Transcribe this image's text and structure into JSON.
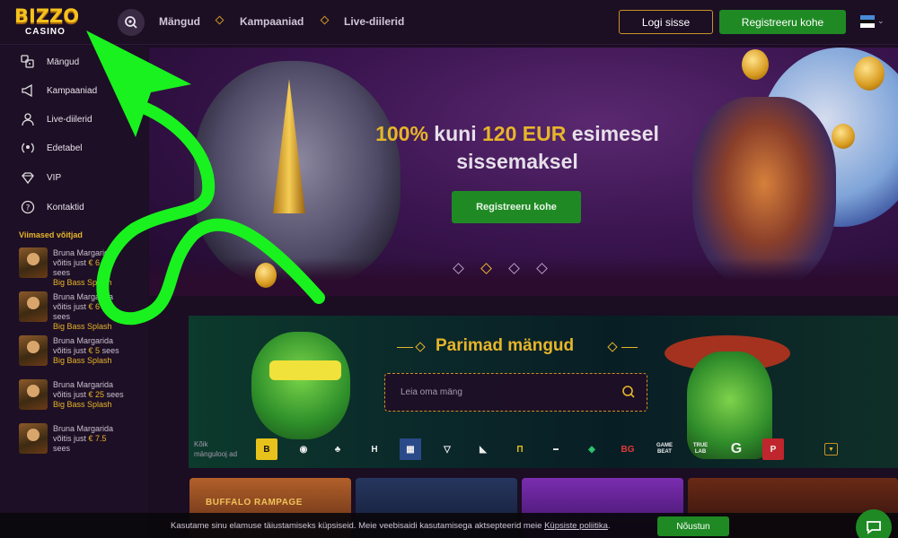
{
  "header": {
    "logo_top": "BIZZO",
    "logo_bottom": "CASINO",
    "nav": [
      "Mängud",
      "Kampaaniad",
      "Live-diilerid"
    ],
    "login_label": "Logi sisse",
    "register_label": "Registreeru kohe"
  },
  "sidebar": {
    "items": [
      {
        "label": "Mängud",
        "icon": "games-icon"
      },
      {
        "label": "Kampaaniad",
        "icon": "megaphone-icon"
      },
      {
        "label": "Live-diilerid",
        "icon": "live-dealer-icon"
      },
      {
        "label": "Edetabel",
        "icon": "laurel-icon"
      },
      {
        "label": "VIP",
        "icon": "diamond-icon"
      },
      {
        "label": "Kontaktid",
        "icon": "question-icon"
      }
    ],
    "winners_title": "Viimased võitjad",
    "winners": [
      {
        "name": "Bruna Margarida",
        "prefix": "võitis just",
        "amount": "€ 6",
        "suffix": "sees",
        "game": "Big Bass Splash"
      },
      {
        "name": "Bruna Margarida",
        "prefix": "võitis just",
        "amount": "€ 6",
        "suffix": "sees",
        "game": "Big Bass Splash"
      },
      {
        "name": "Bruna Margarida",
        "prefix": "võitis just",
        "amount": "€ 5",
        "suffix": "sees",
        "game": "Big Bass Splash"
      },
      {
        "name": "Bruna Margarida",
        "prefix": "võitis just",
        "amount": "€ 25",
        "suffix": "sees",
        "game": "Big Bass Splash"
      },
      {
        "name": "Bruna Margarida",
        "prefix": "võitis just",
        "amount": "€ 7.5",
        "suffix": "sees",
        "game": ""
      }
    ]
  },
  "hero": {
    "title_a": "100%",
    "title_b": " kuni ",
    "title_c": "120 EUR",
    "title_d": " esimesel",
    "title_line2": "sissemaksel",
    "cta_label": "Registreeru kohe",
    "slides": 4,
    "active_slide": 2
  },
  "games": {
    "title": "Parimad mängud",
    "search_placeholder": "Leia oma mäng",
    "providers_label_1": "Kõik",
    "providers_label_2": "mängulooj ad",
    "providers": [
      "B",
      "◉",
      "♣",
      "H",
      "▦",
      "▽",
      "◣",
      "Π",
      "▬",
      "◈",
      "BG",
      "GAME BEAT",
      "TRUE LAB",
      "G",
      "P"
    ],
    "tile_1": "BUFFALO RAMPAGE"
  },
  "cookie": {
    "text": "Kasutame sinu elamuse täiustamiseks küpsiseid. Meie veebisaidi kasutamisega aktsepteerid meie ",
    "link": "Küpsiste poliitika",
    "tail": ".",
    "accept_label": "Nõustun"
  },
  "colors": {
    "accent_gold": "#e7b52a",
    "cta_green": "#1f8a24",
    "annotation_green": "#19f21e"
  }
}
